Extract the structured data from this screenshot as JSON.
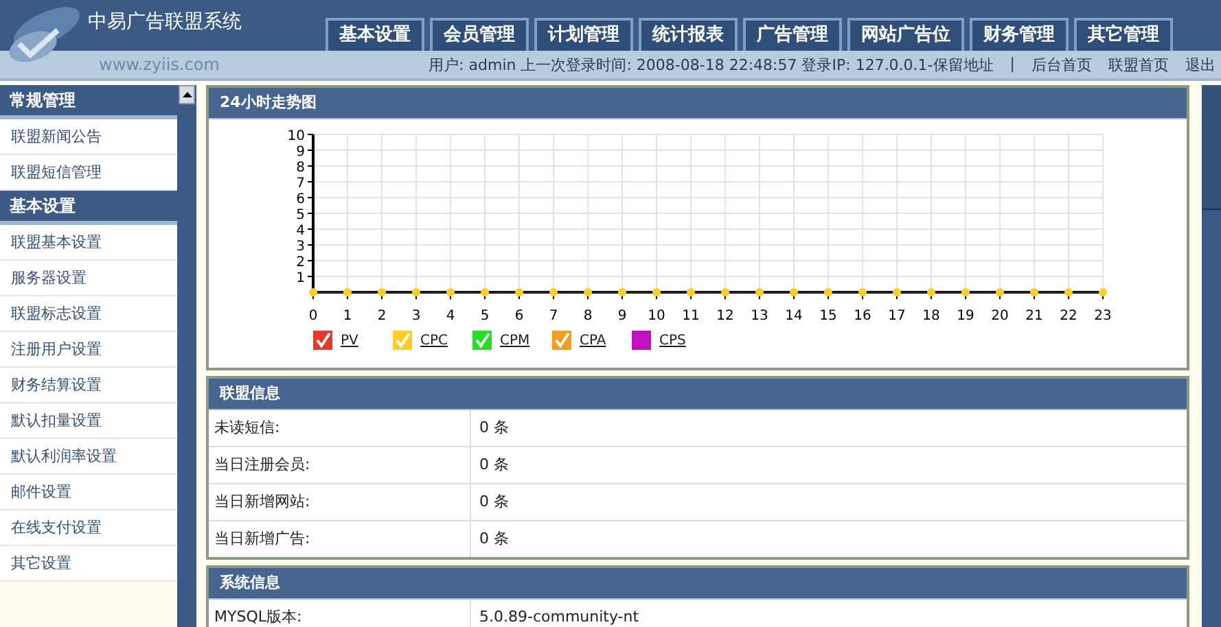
{
  "header": {
    "title": "中易广告联盟系统",
    "site": "www.zyiis.com"
  },
  "tabs": [
    "基本设置",
    "会员管理",
    "计划管理",
    "统计报表",
    "广告管理",
    "网站广告位",
    "财务管理",
    "其它管理"
  ],
  "user_bar": {
    "info": "用户: admin 上一次登录时间: 2008-08-18 22:48:57 登录IP: 127.0.0.1-保留地址",
    "separator": "|",
    "links": [
      "后台首页",
      "联盟首页",
      "退出"
    ]
  },
  "sidebar": [
    {
      "title": "常规管理",
      "items": [
        "联盟新闻公告",
        "联盟短信管理"
      ]
    },
    {
      "title": "基本设置",
      "items": [
        "联盟基本设置",
        "服务器设置",
        "联盟标志设置",
        "注册用户设置",
        "财务结算设置",
        "默认扣量设置",
        "默认利润率设置",
        "邮件设置",
        "在线支付设置",
        "其它设置"
      ]
    }
  ],
  "chart_panel": {
    "title": "24小时走势图",
    "chart_data": {
      "type": "line",
      "grid": true,
      "legend": true,
      "xlim": [
        0,
        23
      ],
      "x": [
        0,
        1,
        2,
        3,
        4,
        5,
        6,
        7,
        8,
        9,
        10,
        11,
        12,
        13,
        14,
        15,
        16,
        17,
        18,
        19,
        20,
        21,
        22,
        23
      ],
      "ylim": [
        0,
        10
      ],
      "yticks": [
        1,
        2,
        3,
        4,
        5,
        6,
        7,
        8,
        9,
        10
      ],
      "xticks": [
        0,
        1,
        2,
        3,
        4,
        5,
        6,
        7,
        8,
        9,
        10,
        11,
        12,
        13,
        14,
        15,
        16,
        17,
        18,
        19,
        20,
        21,
        22,
        23
      ],
      "series": [
        {
          "name": "PV",
          "color": "#e8382a",
          "values": [
            null,
            null,
            null,
            null,
            null,
            null,
            null,
            null,
            null,
            null,
            null,
            null,
            null,
            null,
            null,
            null,
            null,
            null,
            null,
            null,
            null,
            null,
            null,
            null
          ]
        },
        {
          "name": "CPC",
          "color": "#ffcc22",
          "marker": "circle",
          "values": [
            0,
            0,
            0,
            0,
            0,
            0,
            0,
            0,
            0,
            0,
            0,
            0,
            0,
            0,
            0,
            0,
            0,
            0,
            0,
            0,
            0,
            0,
            0,
            0
          ]
        },
        {
          "name": "CPM",
          "color": "#22e022",
          "values": [
            null,
            null,
            null,
            null,
            null,
            null,
            null,
            null,
            null,
            null,
            null,
            null,
            null,
            null,
            null,
            null,
            null,
            null,
            null,
            null,
            null,
            null,
            null,
            null
          ]
        },
        {
          "name": "CPA",
          "color": "#f0a01c",
          "values": [
            null,
            null,
            null,
            null,
            null,
            null,
            null,
            null,
            null,
            null,
            null,
            null,
            null,
            null,
            null,
            null,
            null,
            null,
            null,
            null,
            null,
            null,
            null,
            null
          ]
        },
        {
          "name": "CPS",
          "color": "#c010c0",
          "values": [
            null,
            null,
            null,
            null,
            null,
            null,
            null,
            null,
            null,
            null,
            null,
            null,
            null,
            null,
            null,
            null,
            null,
            null,
            null,
            null,
            null,
            null,
            null,
            null
          ]
        }
      ]
    },
    "legend_checkboxes": [
      {
        "checked": true
      },
      {
        "checked": true
      },
      {
        "checked": true
      },
      {
        "checked": true
      },
      {
        "checked": false
      }
    ]
  },
  "panels": [
    {
      "title": "联盟信息",
      "rows": [
        [
          "未读短信:",
          "0 条"
        ],
        [
          "当日注册会员:",
          "0 条"
        ],
        [
          "当日新增网站:",
          "0 条"
        ],
        [
          "当日新增广告:",
          "0 条"
        ]
      ]
    },
    {
      "title": "系统信息",
      "rows": [
        [
          "MYSQL版本:",
          "5.0.89-community-nt"
        ]
      ]
    }
  ]
}
